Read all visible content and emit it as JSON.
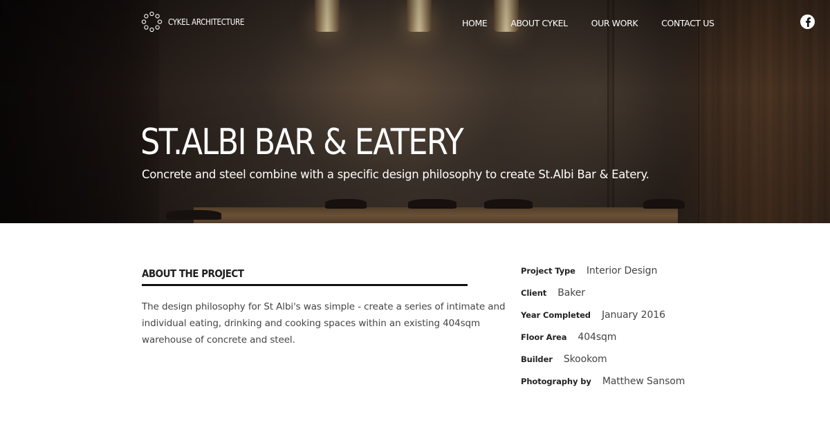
{
  "brand": {
    "name": "CYKEL ARCHITECTURE"
  },
  "nav": {
    "items": [
      {
        "label": "HOME"
      },
      {
        "label": "ABOUT CYKEL"
      },
      {
        "label": "OUR WORK"
      },
      {
        "label": "CONTACT US"
      }
    ]
  },
  "social": {
    "facebook_icon": "facebook-icon"
  },
  "hero": {
    "title": "ST.ALBI BAR & EATERY",
    "subtitle": "Concrete and steel combine with a specific design philosophy to create St.Albi Bar & Eatery."
  },
  "about": {
    "heading": "ABOUT THE PROJECT",
    "body": "The design philosophy for St Albi's was simple - create a series of intimate and individual eating, drinking and cooking spaces within an existing 404sqm warehouse of concrete and steel."
  },
  "details": [
    {
      "label": "Project Type",
      "value": "Interior Design"
    },
    {
      "label": "Client",
      "value": "Baker"
    },
    {
      "label": "Year Completed",
      "value": "January 2016"
    },
    {
      "label": "Floor Area",
      "value": "404sqm"
    },
    {
      "label": "Builder",
      "value": "Skookom"
    },
    {
      "label": "Photography by",
      "value": "Matthew Sansom"
    }
  ],
  "colors": {
    "text_dark": "#222222",
    "text_body": "#444444",
    "hero_text": "#ffffff",
    "rule": "#111111"
  }
}
